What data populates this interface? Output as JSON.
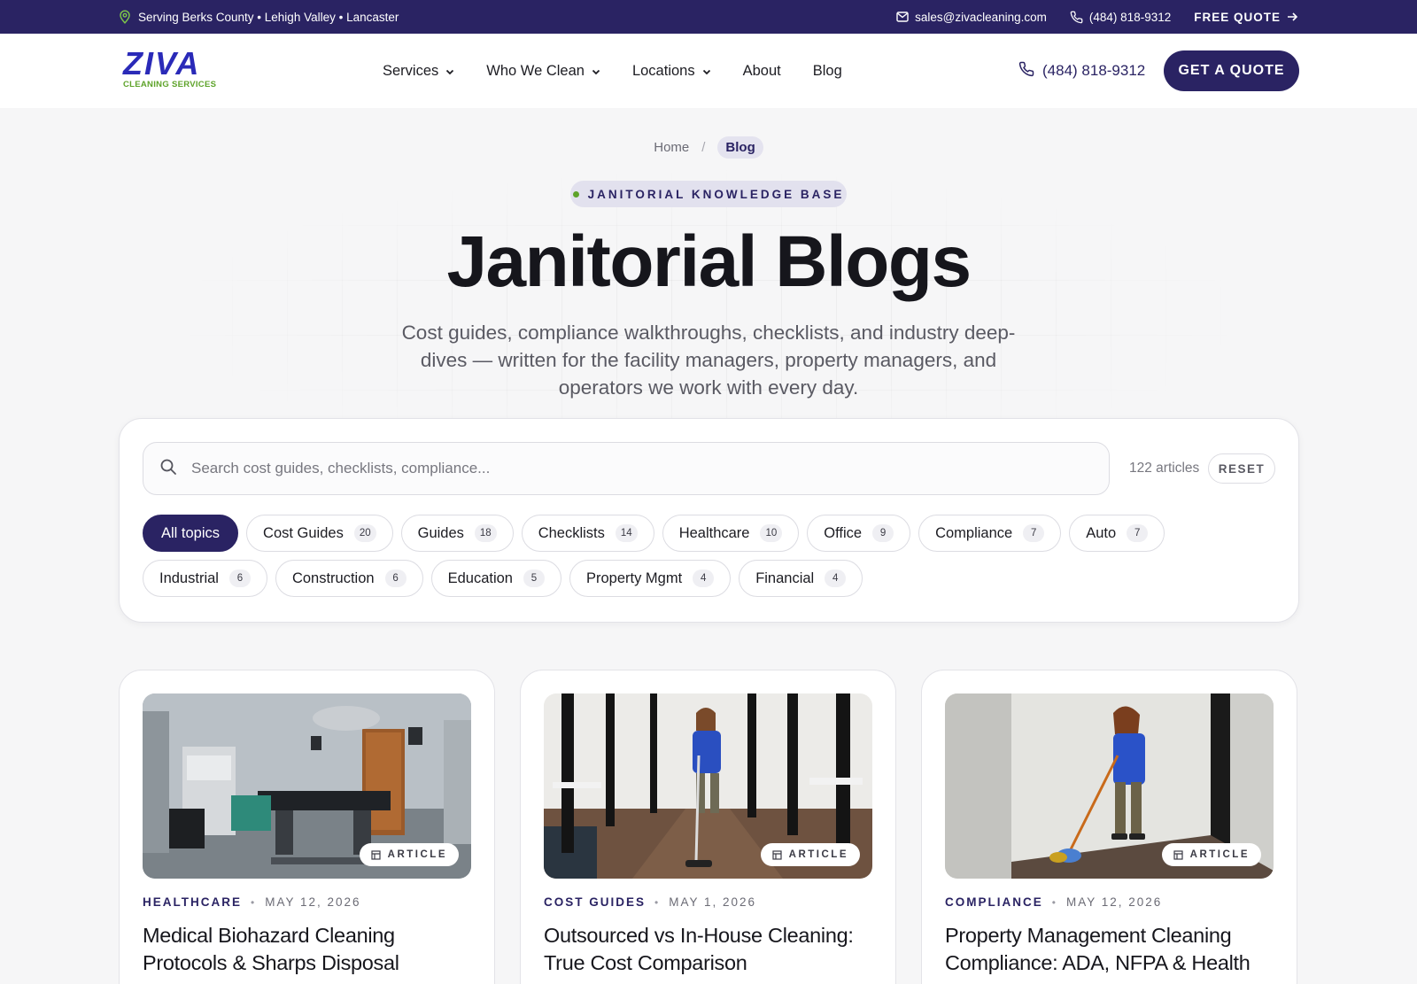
{
  "topbar": {
    "service_area": "Serving Berks County • Lehigh Valley • Lancaster",
    "email": "sales@zivacleaning.com",
    "phone": "(484) 818-9312",
    "quote_label": "FREE QUOTE"
  },
  "header": {
    "logo_word": "ZIVA",
    "logo_sub": "CLEANING SERVICES",
    "nav": [
      {
        "label": "Services",
        "dropdown": true
      },
      {
        "label": "Who We Clean",
        "dropdown": true
      },
      {
        "label": "Locations",
        "dropdown": true
      },
      {
        "label": "About",
        "dropdown": false
      },
      {
        "label": "Blog",
        "dropdown": false
      }
    ],
    "phone": "(484) 818-9312",
    "cta_label": "GET A QUOTE"
  },
  "hero": {
    "breadcrumb": {
      "home": "Home",
      "separator": "/",
      "current": "Blog"
    },
    "kicker": "JANITORIAL KNOWLEDGE BASE",
    "title": "Janitorial Blogs",
    "lede": "Cost guides, compliance walkthroughs, checklists, and industry deep-dives — written for the facility managers, property managers, and operators we work with every day."
  },
  "filters": {
    "search_placeholder": "Search cost guides, checklists, compliance...",
    "search_value": "",
    "article_count": "122 articles",
    "reset_label": "RESET",
    "chips": [
      {
        "label": "All topics",
        "count": "",
        "active": true
      },
      {
        "label": "Cost Guides",
        "count": "20",
        "active": false
      },
      {
        "label": "Guides",
        "count": "18",
        "active": false
      },
      {
        "label": "Checklists",
        "count": "14",
        "active": false
      },
      {
        "label": "Healthcare",
        "count": "10",
        "active": false
      },
      {
        "label": "Office",
        "count": "9",
        "active": false
      },
      {
        "label": "Compliance",
        "count": "7",
        "active": false
      },
      {
        "label": "Auto",
        "count": "7",
        "active": false
      },
      {
        "label": "Industrial",
        "count": "6",
        "active": false
      },
      {
        "label": "Construction",
        "count": "6",
        "active": false
      },
      {
        "label": "Education",
        "count": "5",
        "active": false
      },
      {
        "label": "Property Mgmt",
        "count": "4",
        "active": false
      },
      {
        "label": "Financial",
        "count": "4",
        "active": false
      }
    ]
  },
  "cards": [
    {
      "badge": "ARTICLE",
      "category": "HEALTHCARE",
      "date": "MAY 12, 2026",
      "title": "Medical Biohazard Cleaning Protocols & Sharps Disposal",
      "image": "hospital-operating-room-photo"
    },
    {
      "badge": "ARTICLE",
      "category": "COST GUIDES",
      "date": "MAY 1, 2026",
      "title": "Outsourced vs In-House Cleaning: True Cost Comparison",
      "image": "office-hallway-vacuum-photo"
    },
    {
      "badge": "ARTICLE",
      "category": "COMPLIANCE",
      "date": "MAY 12, 2026",
      "title": "Property Management Cleaning Compliance: ADA, NFPA & Health",
      "image": "floor-mopping-photo"
    }
  ],
  "colors": {
    "brand_navy": "#2a2363",
    "accent_green": "#5ea32a",
    "logo_blue": "#2a2ab8",
    "background": "#f6f6f7"
  },
  "icons": {
    "topbar_location": "map-pin-icon",
    "topbar_email": "mail-icon",
    "topbar_phone": "phone-icon",
    "quote_arrow": "arrow-right-icon",
    "nav_dropdown": "chevron-down-icon",
    "search": "search-icon",
    "badge": "document-icon"
  }
}
